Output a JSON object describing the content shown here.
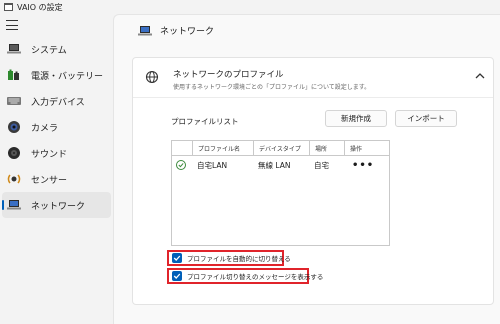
{
  "app": {
    "title": "VAIO の設定"
  },
  "sidebar": {
    "items": [
      {
        "label": "システム",
        "icon": "laptop-icon"
      },
      {
        "label": "電源・バッテリー",
        "icon": "battery-icon"
      },
      {
        "label": "入力デバイス",
        "icon": "keyboard-icon"
      },
      {
        "label": "カメラ",
        "icon": "camera-icon"
      },
      {
        "label": "サウンド",
        "icon": "speaker-icon"
      },
      {
        "label": "センサー",
        "icon": "sensor-icon"
      },
      {
        "label": "ネットワーク",
        "icon": "network-icon",
        "active": true
      }
    ]
  },
  "page": {
    "title": "ネットワーク"
  },
  "profile_card": {
    "title": "ネットワークのプロファイル",
    "description": "使用するネットワーク環境ごとの「プロファイル」について設定します。",
    "expanded": true,
    "list_label": "プロファイルリスト",
    "new_button": "新規作成",
    "import_button": "インポート",
    "table": {
      "headers": [
        "",
        "プロファイル名",
        "デバイスタイプ",
        "場所",
        "操作"
      ],
      "rows": [
        {
          "active": true,
          "name": "自宅LAN",
          "device_type": "無線 LAN",
          "location": "自宅",
          "ops": "•••"
        }
      ]
    },
    "options": [
      {
        "label": "プロファイルを自動的に切り替える",
        "checked": true
      },
      {
        "label": "プロファイル切り替えのメッセージを表示する",
        "checked": true
      }
    ]
  },
  "colors": {
    "accent": "#005fb8",
    "highlight_border": "#e0242b",
    "active_check": "#3c8a3c"
  }
}
